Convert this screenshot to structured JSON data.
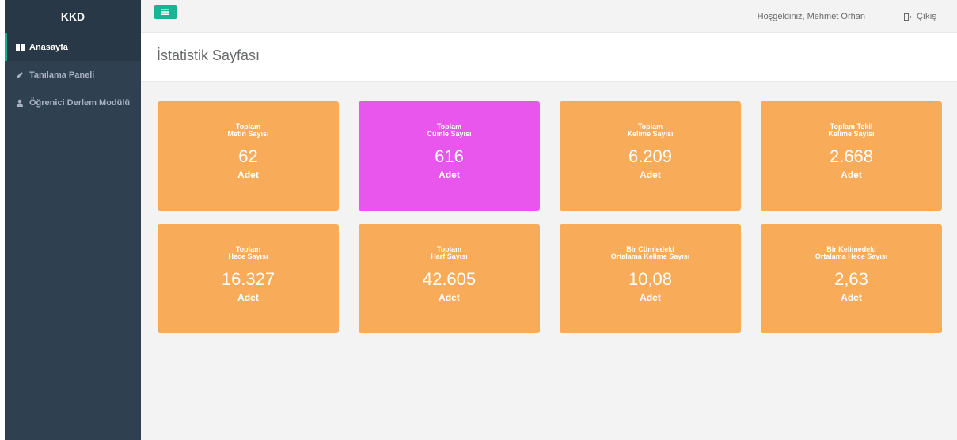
{
  "sidebar": {
    "brand": "KKD",
    "items": [
      {
        "label": "Anasayfa"
      },
      {
        "label": "Tanılama Paneli"
      },
      {
        "label": "Öğrenici Derlem Modülü"
      }
    ]
  },
  "topbar": {
    "welcome": "Hoşgeldiniz, Mehmet Orhan",
    "logout": "Çıkış"
  },
  "page": {
    "title": "İstatistik Sayfası"
  },
  "colors": {
    "orange": "#f8ac59",
    "magenta": "#e856ee",
    "accent": "#1ab394",
    "sidebar": "#2f4050"
  },
  "stats": [
    {
      "line1": "Toplam",
      "line2": "Metin Sayısı",
      "value": "62",
      "unit": "Adet",
      "color": "#f8ac59"
    },
    {
      "line1": "Toplam",
      "line2": "Cümle Sayısı",
      "value": "616",
      "unit": "Adet",
      "color": "#e856ee"
    },
    {
      "line1": "Toplam",
      "line2": "Kelime Sayısı",
      "value": "6.209",
      "unit": "Adet",
      "color": "#f8ac59"
    },
    {
      "line1": "Toplam Tekil",
      "line2": "Kelime Sayısı",
      "value": "2.668",
      "unit": "Adet",
      "color": "#f8ac59"
    },
    {
      "line1": "Toplam",
      "line2": "Hece Sayısı",
      "value": "16.327",
      "unit": "Adet",
      "color": "#f8ac59"
    },
    {
      "line1": "Toplam",
      "line2": "Harf Sayısı",
      "value": "42.605",
      "unit": "Adet",
      "color": "#f8ac59"
    },
    {
      "line1": "Bir Cümledeki",
      "line2": "Ortalama Kelime Sayısı",
      "value": "10,08",
      "unit": "Adet",
      "color": "#f8ac59"
    },
    {
      "line1": "Bir Kelimedeki",
      "line2": "Ortalama Hece Sayısı",
      "value": "2,63",
      "unit": "Adet",
      "color": "#f8ac59"
    }
  ]
}
